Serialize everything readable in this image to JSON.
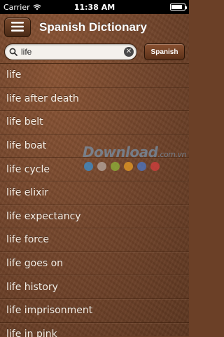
{
  "status_bar": {
    "carrier": "Carrier",
    "time": "11:38 AM",
    "battery_level": 0.85
  },
  "nav": {
    "title": "Spanish Dictionary",
    "menu_icon": "hamburger-icon"
  },
  "search": {
    "value": "life",
    "placeholder": "",
    "search_icon": "magnifier-icon",
    "clear_icon": "clear-icon"
  },
  "language_button": {
    "label": "Spanish"
  },
  "results": [
    "life",
    "life after death",
    "life belt",
    "life boat",
    "life cycle",
    "life elixir",
    "life expectancy",
    "life force",
    "life goes on",
    "life history",
    "life imprisonment",
    "life in pink"
  ],
  "watermark": {
    "text": "Download",
    "suffix": ".com.vn",
    "dot_colors": [
      "#3a8fd0",
      "#b5a8a2",
      "#8fb53a",
      "#e89c24",
      "#4a77c8",
      "#d63d3d"
    ]
  },
  "colors": {
    "text": "#f6efe6",
    "leather": "#74462c",
    "status_bar": "#000000"
  }
}
